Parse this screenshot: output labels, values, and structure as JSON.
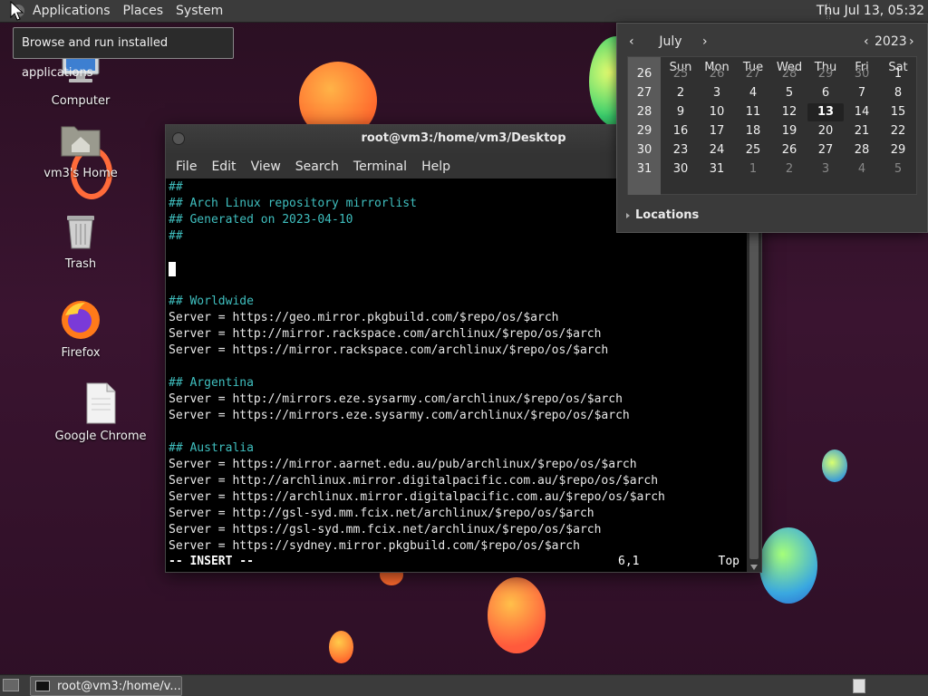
{
  "top_panel": {
    "menus": [
      "Applications",
      "Places",
      "System"
    ],
    "clock": "Thu Jul 13, 05:32"
  },
  "tooltip": "Browse and run installed applications",
  "desktop_icons": [
    {
      "label": "Computer"
    },
    {
      "label": "vm3's Home"
    },
    {
      "label": "Trash"
    },
    {
      "label": "Firefox"
    },
    {
      "label": "Google Chrome"
    }
  ],
  "terminal": {
    "title": "root@vm3:/home/vm3/Desktop",
    "menus": [
      "File",
      "Edit",
      "View",
      "Search",
      "Terminal",
      "Help"
    ],
    "lines": [
      {
        "text": "##",
        "kind": "comment"
      },
      {
        "text": "## Arch Linux repository mirrorlist",
        "kind": "comment"
      },
      {
        "text": "## Generated on 2023-04-10",
        "kind": "comment"
      },
      {
        "text": "##",
        "kind": "comment"
      },
      {
        "text": "",
        "kind": "blank"
      },
      {
        "text": "",
        "kind": "cursor"
      },
      {
        "text": "",
        "kind": "blank"
      },
      {
        "text": "## Worldwide",
        "kind": "comment"
      },
      {
        "text": "Server = https://geo.mirror.pkgbuild.com/$repo/os/$arch",
        "kind": "normal"
      },
      {
        "text": "Server = http://mirror.rackspace.com/archlinux/$repo/os/$arch",
        "kind": "normal"
      },
      {
        "text": "Server = https://mirror.rackspace.com/archlinux/$repo/os/$arch",
        "kind": "normal"
      },
      {
        "text": "",
        "kind": "blank"
      },
      {
        "text": "## Argentina",
        "kind": "comment"
      },
      {
        "text": "Server = http://mirrors.eze.sysarmy.com/archlinux/$repo/os/$arch",
        "kind": "normal"
      },
      {
        "text": "Server = https://mirrors.eze.sysarmy.com/archlinux/$repo/os/$arch",
        "kind": "normal"
      },
      {
        "text": "",
        "kind": "blank"
      },
      {
        "text": "## Australia",
        "kind": "comment"
      },
      {
        "text": "Server = https://mirror.aarnet.edu.au/pub/archlinux/$repo/os/$arch",
        "kind": "normal"
      },
      {
        "text": "Server = http://archlinux.mirror.digitalpacific.com.au/$repo/os/$arch",
        "kind": "normal"
      },
      {
        "text": "Server = https://archlinux.mirror.digitalpacific.com.au/$repo/os/$arch",
        "kind": "normal"
      },
      {
        "text": "Server = http://gsl-syd.mm.fcix.net/archlinux/$repo/os/$arch",
        "kind": "normal"
      },
      {
        "text": "Server = https://gsl-syd.mm.fcix.net/archlinux/$repo/os/$arch",
        "kind": "normal"
      },
      {
        "text": "Server = https://sydney.mirror.pkgbuild.com/$repo/os/$arch",
        "kind": "normal"
      }
    ],
    "status": {
      "mode": "-- INSERT --",
      "position": "6,1",
      "scroll": "Top"
    },
    "colors": {
      "comment": "#3fbfbf",
      "text": "#e8e8e8",
      "background": "#000000"
    }
  },
  "calendar": {
    "month": "July",
    "year": "2023",
    "prev_month": "‹",
    "next_month": "›",
    "prev_year": "‹",
    "next_year": "›",
    "day_names": [
      "Sun",
      "Mon",
      "Tue",
      "Wed",
      "Thu",
      "Fri",
      "Sat"
    ],
    "weeks": [
      {
        "num": "26",
        "days": [
          "25",
          "26",
          "27",
          "28",
          "29",
          "30",
          "1"
        ],
        "other": [
          true,
          true,
          true,
          true,
          true,
          true,
          false
        ]
      },
      {
        "num": "27",
        "days": [
          "2",
          "3",
          "4",
          "5",
          "6",
          "7",
          "8"
        ],
        "other": [
          false,
          false,
          false,
          false,
          false,
          false,
          false
        ]
      },
      {
        "num": "28",
        "days": [
          "9",
          "10",
          "11",
          "12",
          "13",
          "14",
          "15"
        ],
        "other": [
          false,
          false,
          false,
          false,
          false,
          false,
          false
        ]
      },
      {
        "num": "29",
        "days": [
          "16",
          "17",
          "18",
          "19",
          "20",
          "21",
          "22"
        ],
        "other": [
          false,
          false,
          false,
          false,
          false,
          false,
          false
        ]
      },
      {
        "num": "30",
        "days": [
          "23",
          "24",
          "25",
          "26",
          "27",
          "28",
          "29"
        ],
        "other": [
          false,
          false,
          false,
          false,
          false,
          false,
          false
        ]
      },
      {
        "num": "31",
        "days": [
          "30",
          "31",
          "1",
          "2",
          "3",
          "4",
          "5"
        ],
        "other": [
          false,
          false,
          true,
          true,
          true,
          true,
          true
        ]
      }
    ],
    "today": "13",
    "locations_label": "Locations"
  },
  "taskbar": {
    "task_label": "root@vm3:/home/v..."
  }
}
